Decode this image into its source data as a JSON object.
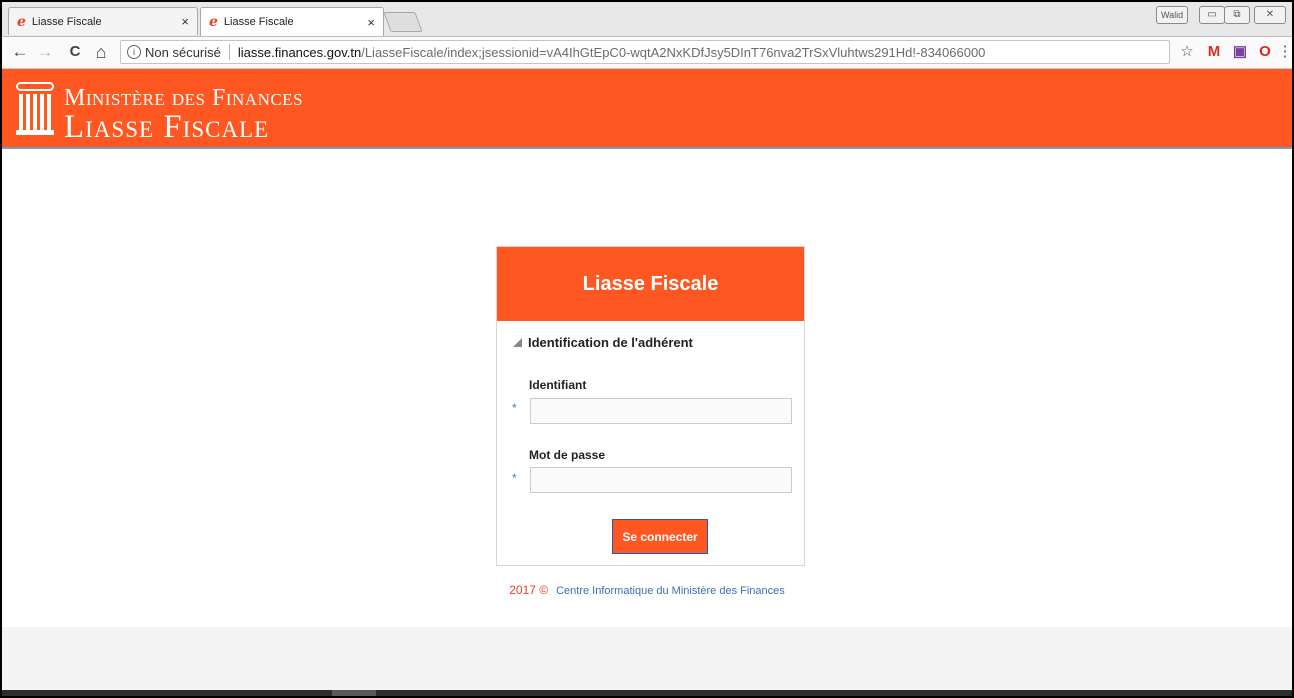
{
  "browser": {
    "tabs": [
      {
        "title": "Liasse Fiscale",
        "close": "×",
        "favicon": "e-icon"
      },
      {
        "title": "Liasse Fiscale",
        "close": "×",
        "favicon": "e-icon"
      }
    ],
    "user_badge": "Walid",
    "window_controls": {
      "minimize": "▭",
      "restore": "⧉",
      "close": "✕"
    },
    "nav": {
      "back": "←",
      "forward": "→",
      "reload": "C",
      "home": "⌂"
    },
    "address": {
      "security_label": "Non sécurisé",
      "host": "liasse.finances.gov.tn",
      "path": "/LiasseFiscale/index;jsessionid=vA4IhGtEpC0-wqtA2NxKDfJsy5DInT76nva2TrSxVluhtws291Hd!-834066000"
    },
    "bookmark_star": "☆",
    "extensions": [
      {
        "name": "gmail-icon",
        "glyph": "M",
        "color": "#d93025"
      },
      {
        "name": "extension-purple-icon",
        "glyph": "▣",
        "color": "#7a3fa0"
      },
      {
        "name": "opera-icon",
        "glyph": "O",
        "color": "#e0241d"
      }
    ],
    "menu": "⋮"
  },
  "header": {
    "line1": "Ministère des Finances",
    "line2": "Liasse Fiscale"
  },
  "login": {
    "title": "Liasse Fiscale",
    "section": "Identification de l'adhérent",
    "identifiant_label": "Identifiant",
    "identifiant_value": "",
    "password_label": "Mot de passe",
    "password_value": "",
    "required_mark": "*",
    "submit_label": "Se connecter"
  },
  "footer": {
    "year": "2017 ©",
    "link": "Centre Informatique du Ministère des Finances"
  },
  "colors": {
    "brand": "#ff5722",
    "link": "#3b6fb5",
    "required": "#3b7fc4"
  }
}
